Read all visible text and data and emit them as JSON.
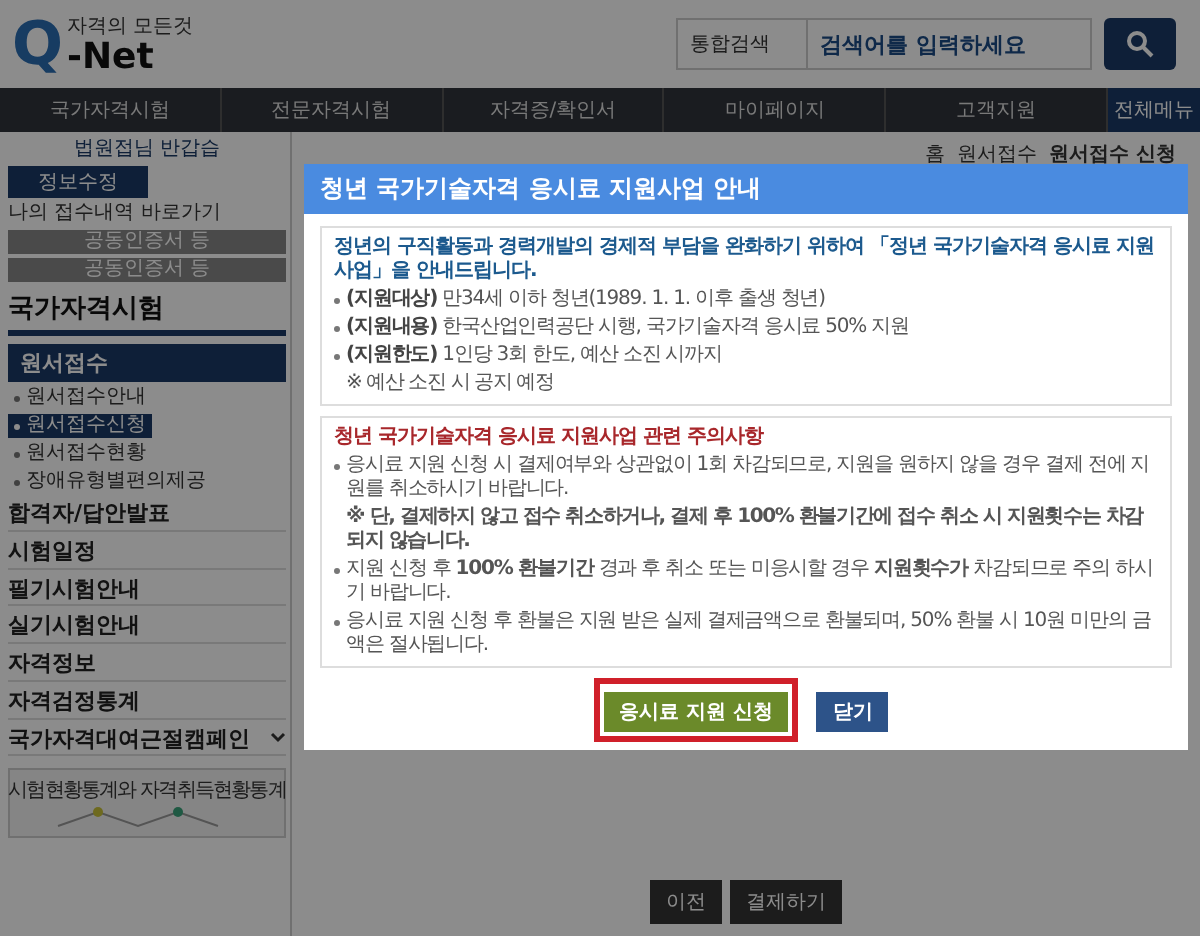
{
  "header": {
    "logo": {
      "tagline": "자격의 모든것",
      "letter": "Q",
      "name": "-Net"
    },
    "search": {
      "scope": "통합검색",
      "placeholder": "검색어를 입력하세요"
    }
  },
  "nav": {
    "items": [
      "국가자격시험",
      "전문자격시험",
      "자격증/확인서",
      "마이페이지",
      "고객지원"
    ],
    "all_menu": "전체메뉴"
  },
  "breadcrumb": [
    "홈",
    "원서접수",
    "원서접수 신청"
  ],
  "sidebar": {
    "greeting": "법원접님 반갑습",
    "edit_button": "정보수정",
    "history_link": "나의 접수내역 바로가기",
    "cert_buttons": [
      "공동인증서 등",
      "공동인증서 등"
    ],
    "section_title": "국가자격시험",
    "menu": {
      "title": "원서접수",
      "items": [
        {
          "label": "원서접수안내",
          "selected": false
        },
        {
          "label": "원서접수신청",
          "selected": true
        },
        {
          "label": "원서접수현황",
          "selected": false
        },
        {
          "label": "장애유형별편의제공",
          "selected": false
        }
      ]
    },
    "links": [
      {
        "label": "합격자/답안발표",
        "kind": "plain"
      },
      {
        "label": "시험일정",
        "kind": "plain"
      },
      {
        "label": "필기시험안내",
        "kind": "plain"
      },
      {
        "label": "실기시험안내",
        "kind": "plain"
      },
      {
        "label": "자격정보",
        "kind": "plain"
      },
      {
        "label": "자격검정통계",
        "kind": "plain"
      },
      {
        "label": "국가자격대여근절캠페인",
        "kind": "dropdown"
      }
    ],
    "stats_card": {
      "title": "시험현황통계와 자격취득현황통계"
    }
  },
  "modal": {
    "title": "청년 국가기술자격 응시료 지원사업 안내",
    "info_box": {
      "lead": "정년의 구직활동과 경력개발의 경제적 부담을 완화하기 위하여 「정년 국가기술자격 응시료 지원사업」을 안내드립니다.",
      "items": [
        {
          "label": "(지원대상)",
          "text": "만34세 이하 청년(1989. 1. 1. 이후 출생 청년)"
        },
        {
          "label": "(지원내용)",
          "text": "한국산업인력공단 시행, 국가기술자격 응시료 50% 지원"
        },
        {
          "label": "(지원한도)",
          "text": "1인당 3회 한도, 예산 소진 시까지",
          "note": "※ 예산 소진 시 공지 예정"
        }
      ]
    },
    "notice_box": {
      "title": "청년 국가기술자격 응시료 지원사업 관련 주의사항",
      "items": [
        {
          "text": "응시료 지원 신청 시 결제여부와 상관없이 1회 차감되므로, 지원을 원하지 않을 경우 결제 전에 지원를 취소하시기 바랍니다.",
          "note": "※ 단, 결제하지 않고 접수 취소하거나, 결제 후 100% 환불기간에 접수 취소 시 지원횟수는 차감되지 않습니다."
        },
        {
          "text": "지원 신청 후 **100% 환불기간** 경과 후 취소 또는 미응시할 경우 **지원횟수가** 차감되므로 주의 하시기 바랍니다."
        },
        {
          "text": "응시료 지원 신청 후 환불은 지원 받은 실제 결제금액으로 환불되며, 50% 환불 시 10원 미만의 금액은 절사됩니다."
        }
      ]
    },
    "buttons": [
      {
        "label": "응시료 지원 신청",
        "kind": "primary",
        "highlighted": true
      },
      {
        "label": "닫기",
        "kind": "secondary",
        "highlighted": false
      }
    ]
  },
  "page_buttons": [
    "이전",
    "결제하기"
  ]
}
